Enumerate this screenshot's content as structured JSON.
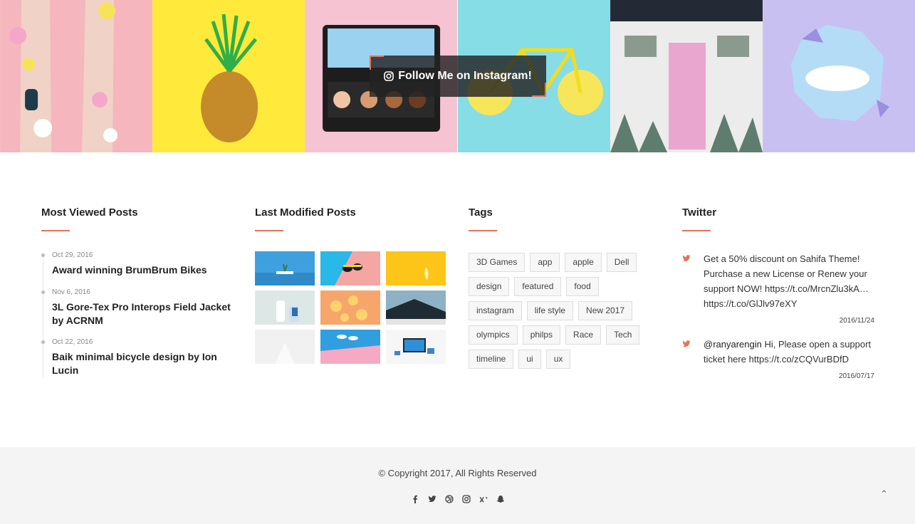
{
  "instagram": {
    "follow_label": "Follow Me on Instagram!",
    "tiles": [
      {
        "icon": "flowers-legs-photo",
        "bg": "#f6b6bd"
      },
      {
        "icon": "pineapple-photo",
        "bg": "#ffe93a"
      },
      {
        "icon": "makeup-palette-photo",
        "bg": "#f6c3d3"
      },
      {
        "icon": "lemon-bicycle-photo",
        "bg": "#86dde6"
      },
      {
        "icon": "pink-door-photo",
        "bg": "#f3f3f3"
      },
      {
        "icon": "torn-paper-sky-photo",
        "bg": "#c9c0f2"
      }
    ]
  },
  "most_viewed": {
    "title": "Most Viewed Posts",
    "posts": [
      {
        "date": "Oct 29, 2016",
        "title": "Award winning BrumBrum Bikes"
      },
      {
        "date": "Nov 6, 2016",
        "title": "3L Gore-Tex Pro Interops Field Jacket by ACRNM"
      },
      {
        "date": "Oct 22, 2016",
        "title": "Baik minimal bicycle design by Ion Lucin"
      }
    ]
  },
  "last_modified": {
    "title": "Last Modified Posts"
  },
  "tags": {
    "title": "Tags",
    "items": [
      "3D Games",
      "app",
      "apple",
      "Dell",
      "design",
      "featured",
      "food",
      "instagram",
      "life style",
      "New 2017",
      "olympics",
      "philps",
      "Race",
      "Tech",
      "timeline",
      "ui",
      "ux"
    ]
  },
  "twitter": {
    "title": "Twitter",
    "tweets": [
      {
        "text": "Get a 50% discount on Sahifa Theme! Purchase a new License or Renew your support NOW! https://t.co/MrcnZlu3kA… https://t.co/GlJlv97eXY",
        "date": "2016/11/24"
      },
      {
        "user": "@ranyarengin",
        "text": " Hi, Please open a support ticket here https://t.co/zCQVurBDfD",
        "date": "2016/07/17"
      }
    ]
  },
  "footer": {
    "copyright": "© Copyright 2017, All Rights Reserved",
    "socials": [
      "facebook-icon",
      "twitter-icon",
      "dribbble-icon",
      "instagram-icon",
      "vk-icon",
      "snapchat-icon"
    ],
    "to_top": "⌃"
  },
  "colors": {
    "accent": "#e3735b",
    "footer_bg": "#f4f4f4"
  }
}
